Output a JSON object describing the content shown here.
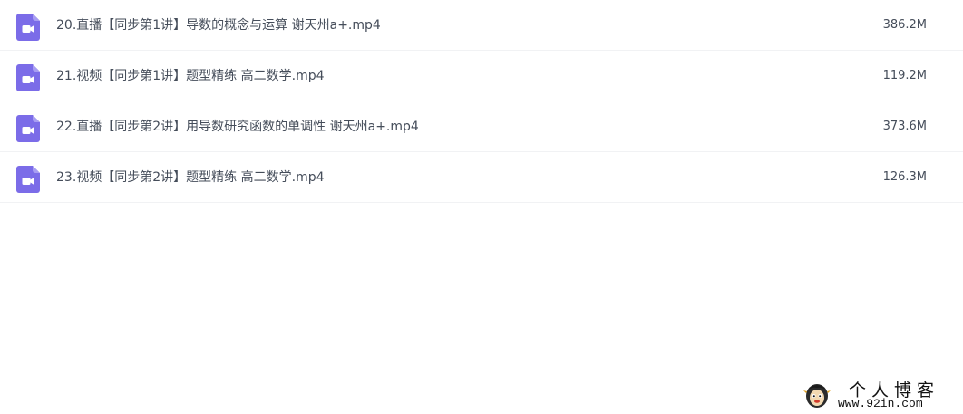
{
  "files": [
    {
      "name": "20.直播【同步第1讲】导数的概念与运算 谢天州a+.mp4",
      "size": "386.2M",
      "icon": "video-file-icon"
    },
    {
      "name": "21.视频【同步第1讲】题型精练 高二数学.mp4",
      "size": "119.2M",
      "icon": "video-file-icon"
    },
    {
      "name": "22.直播【同步第2讲】用导数研究函数的单调性 谢天州a+.mp4",
      "size": "373.6M",
      "icon": "video-file-icon"
    },
    {
      "name": "23.视频【同步第2讲】题型精练 高二数学.mp4",
      "size": "126.3M",
      "icon": "video-file-icon"
    }
  ],
  "watermark": {
    "title": "个人博客",
    "url": "www.92in.com"
  },
  "colors": {
    "icon_purple": "#7b6ce8",
    "text": "#454d5a",
    "divider": "#f1f2f4"
  }
}
